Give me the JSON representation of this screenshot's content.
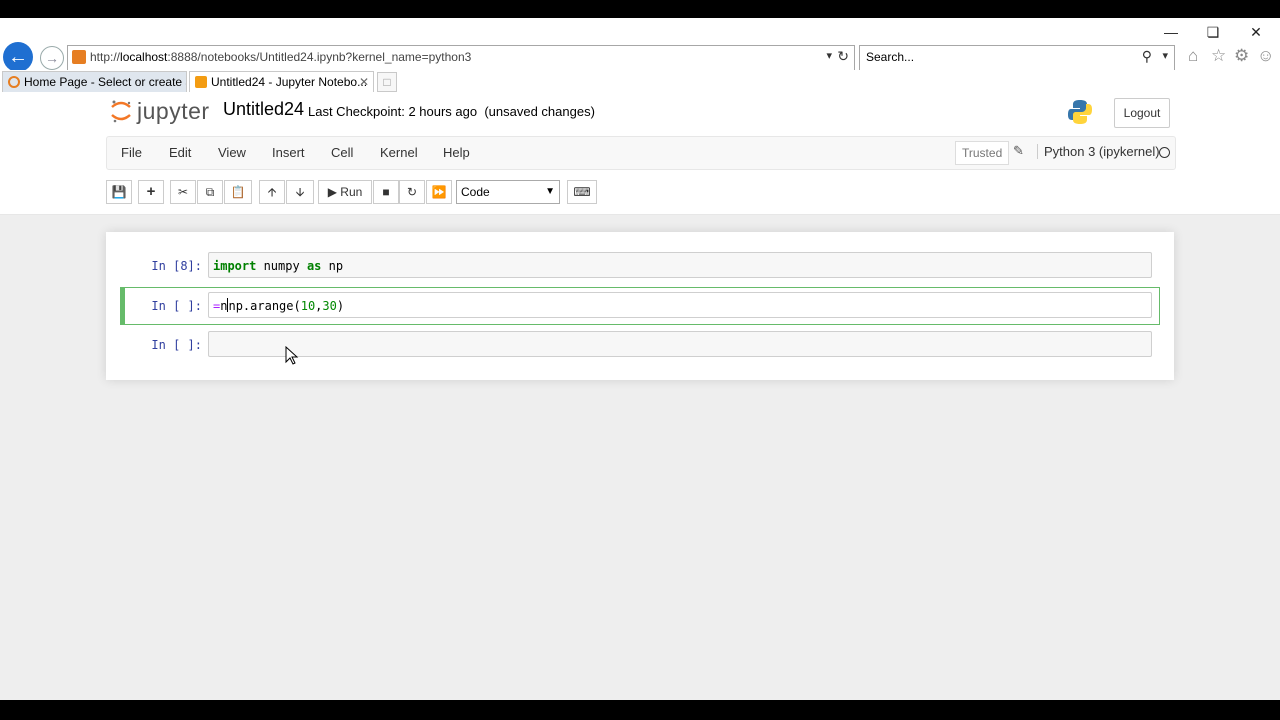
{
  "browser": {
    "url_prefix": "http://",
    "url_host": "localhost",
    "url_rest": ":8888/notebooks/Untitled24.ipynb?kernel_name=python3",
    "search_placeholder": "Search...",
    "tabs": [
      {
        "label": "Home Page - Select or create a..."
      },
      {
        "label": "Untitled24 - Jupyter Notebo..."
      }
    ]
  },
  "header": {
    "logo_text": "jupyter",
    "notebook_name": "Untitled24",
    "checkpoint": "Last Checkpoint: 2 hours ago",
    "unsaved": "(unsaved changes)",
    "logout_label": "Logout"
  },
  "menu": {
    "items": [
      "File",
      "Edit",
      "View",
      "Insert",
      "Cell",
      "Kernel",
      "Help"
    ],
    "trusted_label": "Trusted",
    "kernel_name": "Python 3 (ipykernel)"
  },
  "toolbar": {
    "run_label": "Run",
    "cell_type": "Code"
  },
  "cells": [
    {
      "prompt": "In [8]:",
      "code_kw1": "import",
      "code_mid": " numpy ",
      "code_kw2": "as",
      "code_end": " np"
    },
    {
      "prompt": "In [ ]:",
      "code_op": "=",
      "code_a": "n",
      "code_b": "np.arange(",
      "code_n1": "10",
      "code_c": ",",
      "code_n2": "30",
      "code_d": ")"
    },
    {
      "prompt": "In [ ]:"
    }
  ],
  "colors": {
    "accent_blue": "#1f6fd1",
    "selected_cell_border": "#66bb6a",
    "prompt_color": "#303f9f",
    "keyword_green": "#008000"
  }
}
